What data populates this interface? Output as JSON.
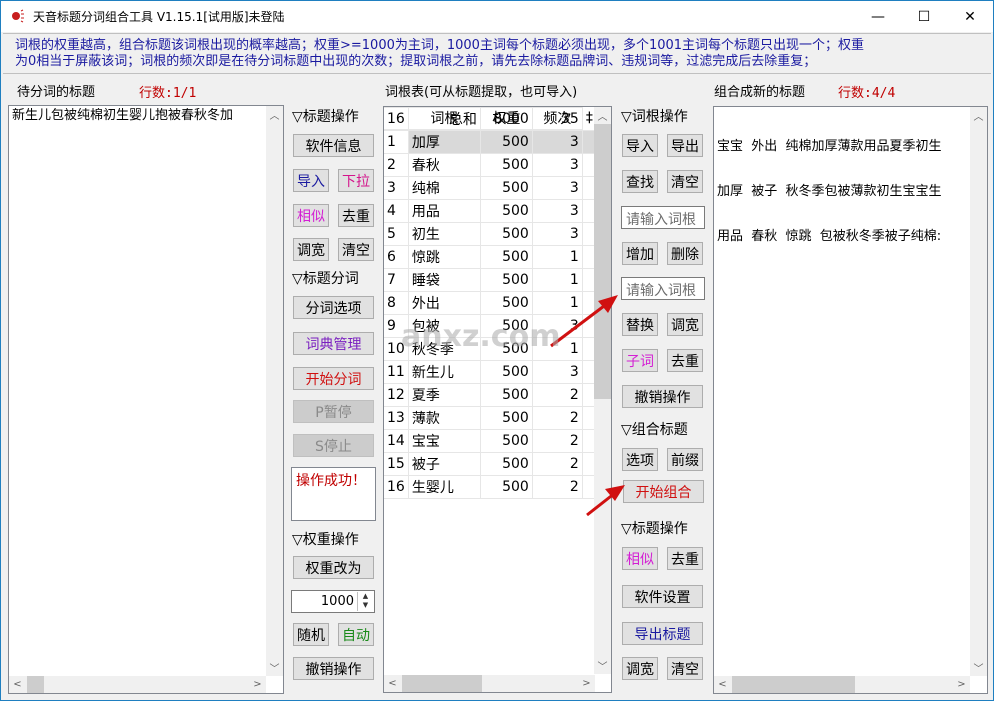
{
  "window": {
    "title": "天音标题分词组合工具 V1.15.1[试用版]未登陆",
    "controls": {
      "minimize": "—",
      "maximize": "☐",
      "close": "✕"
    }
  },
  "info": {
    "line1": "词根的权重越高，组合标题该词根出现的概率越高；权重>=1000为主词，1000主词每个标题必须出现，多个1001主词每个标题只出现一个；权重",
    "line2": "为0相当于屏蔽该词；词根的频次即是在待分词标题中出现的次数；提取词根之前，请先去除标题品牌词、违规词等，过滤完成后去除重复；"
  },
  "left_panel": {
    "label": "待分词的标题",
    "count": "行数:1/1",
    "content": "新生儿包被纯棉初生婴儿抱被春秋冬加"
  },
  "title_ops": {
    "header": "▽标题操作",
    "software_info": "软件信息",
    "import": "导入",
    "dropdown": "下拉",
    "similar": "相似",
    "dedupe": "去重",
    "widen": "调宽",
    "clear": "清空",
    "seg_header": "▽标题分词",
    "seg_options": "分词选项",
    "dict_manage": "词典管理",
    "start_seg": "开始分词",
    "pause": "P暂停",
    "stop": "S停止",
    "status": "操作成功！",
    "weight_header": "▽权重操作",
    "weight_change": "权重改为",
    "weight_value": "1000",
    "random": "随机",
    "auto": "自动",
    "undo": "撤销操作"
  },
  "word_table": {
    "label": "词根表(可从标题提取，也可导入)",
    "columns": [
      "",
      "词根",
      "权重",
      "频次",
      "‡"
    ],
    "rows": [
      {
        "idx": "1",
        "word": "加厚",
        "weight": "500",
        "freq": "3"
      },
      {
        "idx": "2",
        "word": "春秋",
        "weight": "500",
        "freq": "3"
      },
      {
        "idx": "3",
        "word": "纯棉",
        "weight": "500",
        "freq": "3"
      },
      {
        "idx": "4",
        "word": "用品",
        "weight": "500",
        "freq": "3"
      },
      {
        "idx": "5",
        "word": "初生",
        "weight": "500",
        "freq": "3"
      },
      {
        "idx": "6",
        "word": "惊跳",
        "weight": "500",
        "freq": "1"
      },
      {
        "idx": "7",
        "word": "睡袋",
        "weight": "500",
        "freq": "1"
      },
      {
        "idx": "8",
        "word": "外出",
        "weight": "500",
        "freq": "1"
      },
      {
        "idx": "9",
        "word": "包被",
        "weight": "500",
        "freq": "3"
      },
      {
        "idx": "10",
        "word": "秋冬季",
        "weight": "500",
        "freq": "1"
      },
      {
        "idx": "11",
        "word": "新生儿",
        "weight": "500",
        "freq": "3"
      },
      {
        "idx": "12",
        "word": "夏季",
        "weight": "500",
        "freq": "2"
      },
      {
        "idx": "13",
        "word": "薄款",
        "weight": "500",
        "freq": "2"
      },
      {
        "idx": "14",
        "word": "宝宝",
        "weight": "500",
        "freq": "2"
      },
      {
        "idx": "15",
        "word": "被子",
        "weight": "500",
        "freq": "2"
      },
      {
        "idx": "16",
        "word": "生婴儿",
        "weight": "500",
        "freq": "2"
      }
    ],
    "total": {
      "idx": "16",
      "label": "总和",
      "weight": "8000",
      "freq": "35"
    }
  },
  "root_ops": {
    "header": "▽词根操作",
    "import": "导入",
    "export": "导出",
    "find": "查找",
    "clear": "清空",
    "input1_placeholder": "请输入词根",
    "add": "增加",
    "delete": "删除",
    "input2_placeholder": "请输入词根",
    "replace": "替换",
    "widen": "调宽",
    "subword": "子词",
    "dedupe": "去重",
    "undo": "撤销操作",
    "combine_header": "▽组合标题",
    "options": "选项",
    "prefix": "前缀",
    "start_combine": "开始组合",
    "title_header": "▽标题操作",
    "similar": "相似",
    "dedupe2": "去重",
    "settings": "软件设置",
    "export_titles": "导出标题",
    "widen2": "调宽",
    "clear2": "清空"
  },
  "right_panel": {
    "label": "组合成新的标题",
    "count": "行数:4/4",
    "lines": [
      "宝宝  外出  纯棉加厚薄款用品夏季初生",
      "加厚  被子  秋冬季包被薄款初生宝宝生",
      "用品  春秋  惊跳  包被秋冬季被子纯棉:"
    ]
  },
  "colors": {
    "info_text": "#1a1aa0",
    "count_red": "#c00000",
    "blue_btn": "#1a1aa0",
    "pink_btn": "#d4148c",
    "magenta_btn": "#d41fd4",
    "purple_btn": "#7a1fc0",
    "red_btn": "#d01010",
    "green_btn": "#1a8a1a"
  },
  "watermark": "anxz.com"
}
